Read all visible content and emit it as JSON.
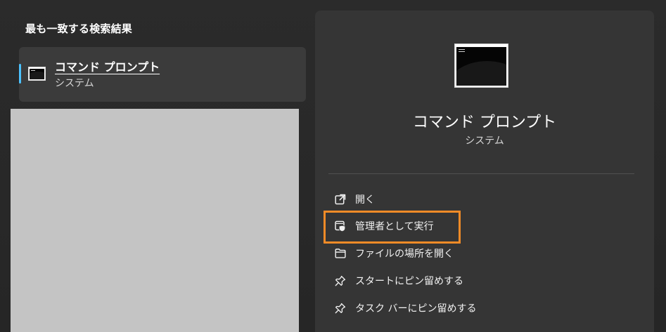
{
  "left_panel": {
    "section_title": "最も一致する検索結果",
    "best_match": {
      "title": "コマンド プロンプト",
      "subtitle": "システム",
      "icon": "command-prompt-icon"
    },
    "placeholder_color": "#c4c4c4"
  },
  "details": {
    "title": "コマンド プロンプト",
    "subtitle": "システム",
    "icon": "command-prompt-icon",
    "actions": [
      {
        "label": "開く",
        "icon": "open-external-icon"
      },
      {
        "label": "管理者として実行",
        "icon": "run-as-administrator-shield-icon"
      },
      {
        "label": "ファイルの場所を開く",
        "icon": "folder-icon"
      },
      {
        "label": "スタートにピン留めする",
        "icon": "pin-icon"
      },
      {
        "label": "タスク バーにピン留めする",
        "icon": "pin-icon"
      }
    ]
  },
  "colors": {
    "background": "#272727",
    "panel": "#353535",
    "selected_item": "#3b3b3b",
    "selection_accent": "#4cc2ff",
    "highlight": "#f28b27"
  }
}
